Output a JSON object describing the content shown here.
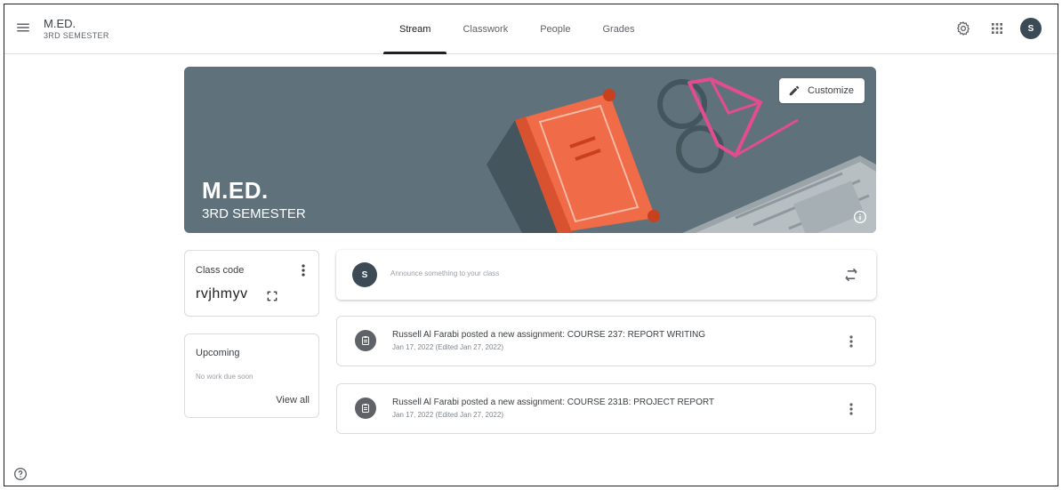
{
  "header": {
    "class_name": "M.ED.",
    "class_section": "3RD SEMESTER",
    "tabs": [
      {
        "label": "Stream",
        "active": true
      },
      {
        "label": "Classwork",
        "active": false
      },
      {
        "label": "People",
        "active": false
      },
      {
        "label": "Grades",
        "active": false
      }
    ],
    "avatar_initial": "S",
    "icons": [
      "menu-icon",
      "settings-icon",
      "apps-grid-icon"
    ]
  },
  "banner": {
    "title": "M.ED.",
    "subtitle": "3RD SEMESTER",
    "customize_label": "Customize",
    "background_color": "#5f717a",
    "icons": [
      "pencil-icon",
      "info-icon"
    ]
  },
  "class_code": {
    "label": "Class code",
    "value": "rvjhmyv",
    "icons": [
      "more-vert-icon",
      "fullscreen-icon"
    ]
  },
  "upcoming": {
    "title": "Upcoming",
    "empty_text": "No work due soon",
    "view_all_label": "View all"
  },
  "announce": {
    "avatar_initial": "S",
    "placeholder": "Announce something to your class",
    "icons": [
      "repost-icon"
    ]
  },
  "posts": [
    {
      "title": "Russell Al Farabi posted a new assignment: COURSE 237: REPORT WRITING",
      "date": "Jan 17, 2022 (Edited Jan 27, 2022)",
      "icon": "assignment-icon"
    },
    {
      "title": "Russell Al Farabi posted a new assignment: COURSE 231B: PROJECT REPORT",
      "date": "Jan 17, 2022 (Edited Jan 27, 2022)",
      "icon": "assignment-icon"
    }
  ],
  "footer": {
    "icons": [
      "help-icon"
    ]
  }
}
